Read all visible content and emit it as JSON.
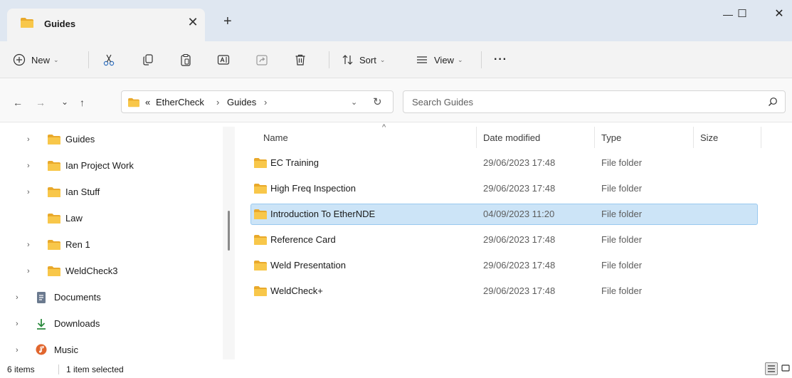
{
  "window": {
    "tab_title": "Guides",
    "tab_close_glyph": "✕",
    "new_tab_glyph": "+",
    "minimize_glyph": "—",
    "maximize_glyph": "☐",
    "close_glyph": "✕"
  },
  "toolbar": {
    "new_label": "New",
    "sort_label": "Sort",
    "view_label": "View",
    "more_label": "···",
    "caret": "⌄",
    "icons": [
      "new-icon",
      "cut-icon",
      "copy-icon",
      "paste-icon",
      "rename-icon",
      "share-icon",
      "delete-icon",
      "sort-icon",
      "view-icon",
      "more-icon"
    ]
  },
  "navigation": {
    "back_glyph": "←",
    "forward_glyph": "→",
    "recent_glyph": "⌄",
    "up_glyph": "↑",
    "breadcrumb": {
      "overflow": "«",
      "items": [
        "EtherCheck",
        "Guides"
      ],
      "separator": "›"
    },
    "address_dropdown_glyph": "⌄",
    "refresh_glyph": "↻",
    "search_placeholder": "Search Guides"
  },
  "nav_pane": {
    "items": [
      {
        "label": "Guides",
        "icon": "folder-icon",
        "expandable": true
      },
      {
        "label": "Ian Project Work",
        "icon": "folder-icon",
        "expandable": true
      },
      {
        "label": "Ian Stuff",
        "icon": "folder-icon",
        "expandable": true
      },
      {
        "label": "Law",
        "icon": "folder-icon",
        "expandable": false
      },
      {
        "label": "Ren 1",
        "icon": "folder-icon",
        "expandable": true
      },
      {
        "label": "WeldCheck3",
        "icon": "folder-icon",
        "expandable": true
      },
      {
        "label": "Documents",
        "icon": "documents-icon",
        "expandable": true
      },
      {
        "label": "Downloads",
        "icon": "downloads-icon",
        "expandable": true
      },
      {
        "label": "Music",
        "icon": "music-icon",
        "expandable": true
      }
    ],
    "chevron_glyph": "›"
  },
  "file_list": {
    "columns": {
      "name": "Name",
      "date": "Date modified",
      "type": "Type",
      "size": "Size"
    },
    "sort_glyph": "^",
    "rows": [
      {
        "name": "EC Training",
        "date": "29/06/2023 17:48",
        "type": "File folder",
        "selected": false
      },
      {
        "name": "High Freq Inspection",
        "date": "29/06/2023 17:48",
        "type": "File folder",
        "selected": false
      },
      {
        "name": "Introduction To EtherNDE",
        "date": "04/09/2023 11:20",
        "type": "File folder",
        "selected": true
      },
      {
        "name": "Reference Card",
        "date": "29/06/2023 17:48",
        "type": "File folder",
        "selected": false
      },
      {
        "name": "Weld Presentation",
        "date": "29/06/2023 17:48",
        "type": "File folder",
        "selected": false
      },
      {
        "name": "WeldCheck+",
        "date": "29/06/2023 17:48",
        "type": "File folder",
        "selected": false
      }
    ]
  },
  "status_bar": {
    "item_count": "6 items",
    "selection": "1 item selected"
  },
  "colors": {
    "folder": "#f8c74a",
    "selection": "#cce4f7",
    "titlebar": "#dfe7f1",
    "downloads_accent": "#2b8a3e",
    "music_accent": "#e1662e"
  }
}
